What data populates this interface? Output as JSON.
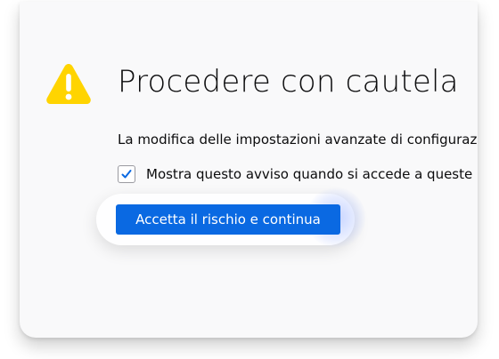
{
  "page": {
    "title": "Procedere con cautela",
    "description": "La modifica delle impostazioni avanzate di configurazio",
    "checkbox": {
      "label": "Mostra questo avviso quando si accede a queste p",
      "checked": true
    },
    "button_label": "Accetta il rischio e continua",
    "icon": "warning-triangle-icon"
  },
  "colors": {
    "warning": "#ffd400",
    "accent": "#0a69e2",
    "background": "#f9f9fa",
    "text": "#0c0c0d"
  }
}
